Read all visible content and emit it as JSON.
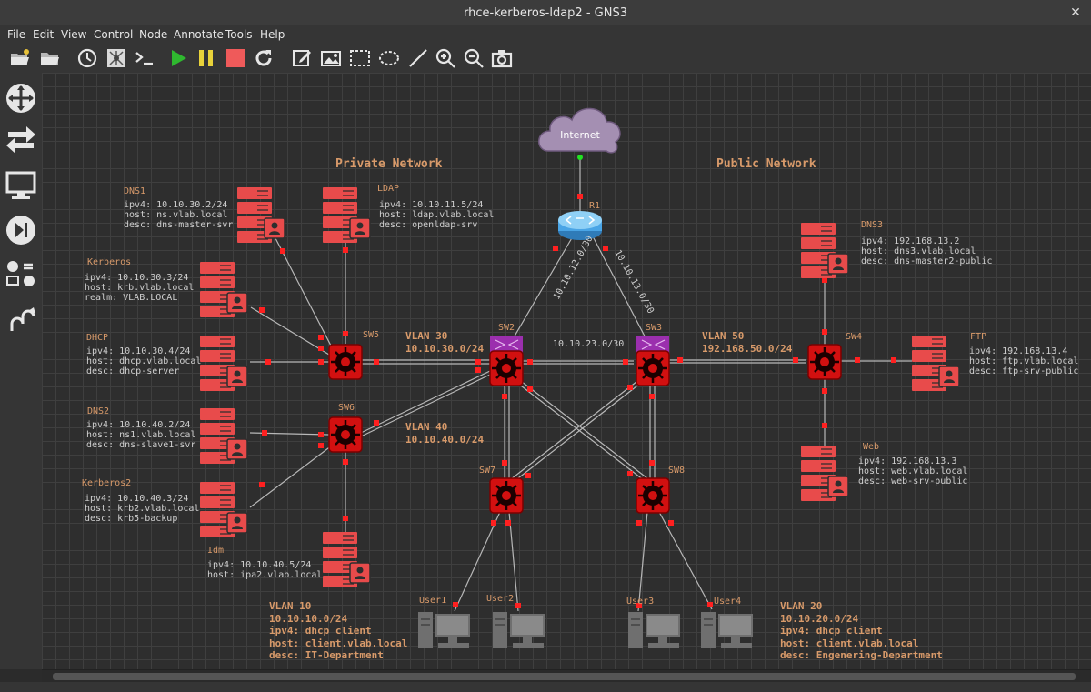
{
  "window": {
    "title": "rhce-kerberos-ldap2 - GNS3",
    "close_glyph": "✕"
  },
  "menu": [
    "File",
    "Edit",
    "View",
    "Control",
    "Node",
    "Annotate",
    "Tools",
    "Help"
  ],
  "toolbar_icons": [
    "open-project",
    "open-folder",
    "snapshot-clock",
    "topology-summary",
    "console",
    "start",
    "suspend",
    "stop",
    "reload",
    "add-note",
    "insert-picture",
    "draw-rectangle",
    "draw-ellipse",
    "draw-line",
    "zoom-in",
    "zoom-out",
    "screenshot"
  ],
  "dock_icons": [
    "routers",
    "switches",
    "end-devices",
    "security-devices",
    "all-devices",
    "add-link"
  ],
  "areas": {
    "private": "Private Network",
    "public": "Public Network"
  },
  "cloud": {
    "label": "Internet"
  },
  "links": {
    "r1_sw2": "10.10.12.0/30",
    "r1_sw3": "10.10.13.0/30",
    "sw2_sw3": "10.10.23.0/30"
  },
  "vlans": {
    "v30": {
      "name": "VLAN 30",
      "net": "10.10.30.0/24"
    },
    "v40": {
      "name": "VLAN 40",
      "net": "10.10.40.0/24"
    },
    "v50": {
      "name": "VLAN 50",
      "net": "192.168.50.0/24"
    },
    "v10": {
      "name": "VLAN 10",
      "net": "10.10.10.0/24",
      "ipv4": "ipv4: dhcp client",
      "host": "host: client.vlab.local",
      "desc": "desc: IT-Department"
    },
    "v20": {
      "name": "VLAN 20",
      "net": "10.10.20.0/24",
      "ipv4": "ipv4: dhcp client",
      "host": "host: client.vlab.local",
      "desc": "desc: Engenering-Department"
    }
  },
  "nodes": {
    "r1": "R1",
    "sw2": "SW2",
    "sw3": "SW3",
    "sw4": "SW4",
    "sw5": "SW5",
    "sw6": "SW6",
    "sw7": "SW7",
    "sw8": "SW8",
    "user1": "User1",
    "user2": "User2",
    "user3": "User3",
    "user4": "User4"
  },
  "servers": {
    "dns1": {
      "name": "DNS1",
      "l1": "ipv4: 10.10.30.2/24",
      "l2": "host: ns.vlab.local",
      "l3": "desc: dns-master-svr"
    },
    "ldap": {
      "name": "LDAP",
      "l1": "ipv4: 10.10.11.5/24",
      "l2": "host: ldap.vlab.local",
      "l3": "desc: openldap-srv"
    },
    "kerberos": {
      "name": "Kerberos",
      "l1": "ipv4: 10.10.30.3/24",
      "l2": "host: krb.vlab.local",
      "l3": "realm: VLAB.LOCAL"
    },
    "dhcp": {
      "name": "DHCP",
      "l1": "ipv4: 10.10.30.4/24",
      "l2": "host: dhcp.vlab.local",
      "l3": "desc: dhcp-server"
    },
    "dns2": {
      "name": "DNS2",
      "l1": "ipv4: 10.10.40.2/24",
      "l2": "host: ns1.vlab.local",
      "l3": "desc: dns-slave1-svr"
    },
    "kerberos2": {
      "name": "Kerberos2",
      "l1": "ipv4: 10.10.40.3/24",
      "l2": "host: krb2.vlab.local",
      "l3": "desc: krb5-backup"
    },
    "idm": {
      "name": "Idm",
      "l1": "ipv4: 10.10.40.5/24",
      "l2": "host: ipa2.vlab.local"
    },
    "dns3": {
      "name": "DNS3",
      "l1": "ipv4: 192.168.13.2",
      "l2": "host: dns3.vlab.local",
      "l3": "desc: dns-master2-public"
    },
    "ftp": {
      "name": "FTP",
      "l1": "ipv4: 192.168.13.4",
      "l2": "host: ftp.vlab.local",
      "l3": "desc: ftp-srv-public"
    },
    "web": {
      "name": "Web",
      "l1": "ipv4: 192.168.13.3",
      "l2": "host: web.vlab.local",
      "l3": "desc: web-srv-public"
    }
  },
  "colors": {
    "label_orange": "#d89a6a",
    "text_gray": "#cfcfcf",
    "server_red": "#e84b4b",
    "switch_red": "#d21010",
    "link": "#b8b8b8",
    "endpoint": "#ff2020"
  }
}
